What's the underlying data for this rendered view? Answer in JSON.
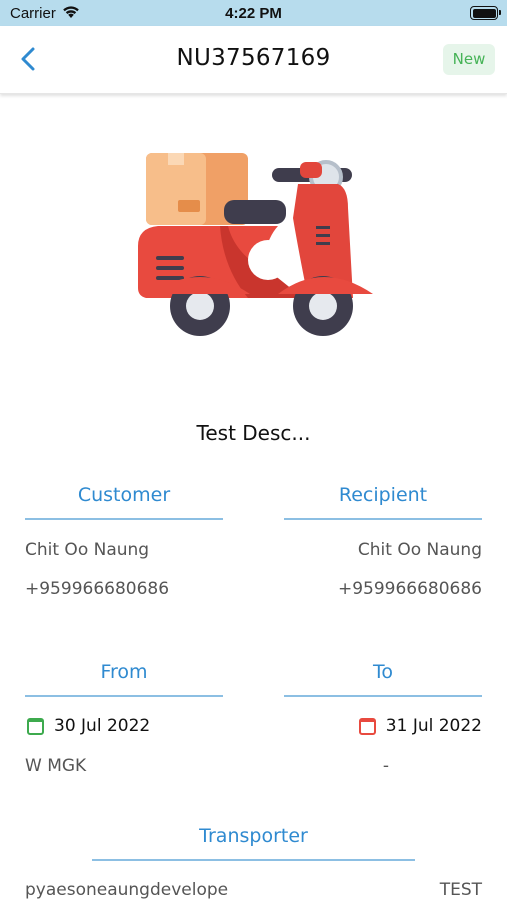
{
  "status_bar": {
    "carrier": "Carrier",
    "time": "4:22 PM"
  },
  "header": {
    "title": "NU37567169",
    "badge": "New"
  },
  "description": "Test Desc...",
  "customer": {
    "heading": "Customer",
    "name": "Chit Oo Naung",
    "phone": "+959966680686"
  },
  "recipient": {
    "heading": "Recipient",
    "name": "Chit Oo Naung",
    "phone": "+959966680686"
  },
  "from": {
    "heading": "From",
    "date": "30 Jul 2022",
    "location": "W MGK"
  },
  "to": {
    "heading": "To",
    "date": "31 Jul 2022",
    "location": "-"
  },
  "transporter": {
    "heading": "Transporter",
    "name": "pyaesoneaungdevelope",
    "vehicle": "TEST"
  },
  "icons": {
    "back": "chevron-left-icon",
    "wifi": "wifi-icon",
    "battery": "battery-icon",
    "calendar": "calendar-icon",
    "scooter": "delivery-scooter-illustration"
  },
  "colors": {
    "accent": "#2f8ad0",
    "status_bar": "#b7dced",
    "badge_bg": "#e6f5ea",
    "badge_text": "#46b357",
    "from_calendar": "#3daa4e",
    "to_calendar": "#e84a3f"
  }
}
